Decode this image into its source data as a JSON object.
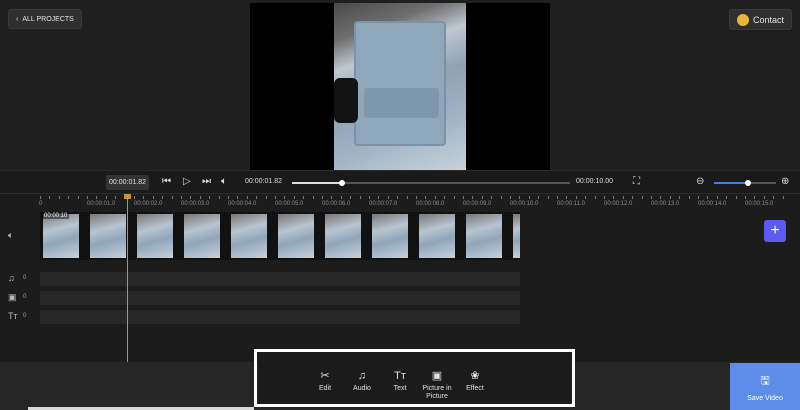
{
  "header": {
    "back_label": "ALL PROJECTS",
    "contact_label": "Contact"
  },
  "player": {
    "timecode_box": "00:00:01.82",
    "current_time": "00:00:01.82",
    "end_time": "00:00:10.00",
    "progress": 0.18,
    "zoom_level": 0.55
  },
  "timeline": {
    "ruler_labels": [
      "0",
      "00:00:01.0",
      "00:00:02.0",
      "00:00:03.0",
      "00:00:04.0",
      "00:00:05.0",
      "00:00:06.0",
      "00:00:07.0",
      "00:00:08.0",
      "00:00:09.0",
      "00:00:10.0",
      "00:00:11.0",
      "00:00:12.0",
      "00:00:13.0",
      "00:00:14.0",
      "00:00:15.0"
    ],
    "clip_duration": "00:00:10",
    "audio_count": "0",
    "pip_count": "0",
    "text_count": "0"
  },
  "toolbar": {
    "edit_label": "Edit",
    "audio_label": "Audio",
    "text_label": "Text",
    "pip_label": "Picture in Picture",
    "effect_label": "Effect",
    "save_label": "Save Video"
  },
  "colors": {
    "accent": "#5b5bf0",
    "save": "#5d8de8",
    "playhead": "#c8913a"
  }
}
